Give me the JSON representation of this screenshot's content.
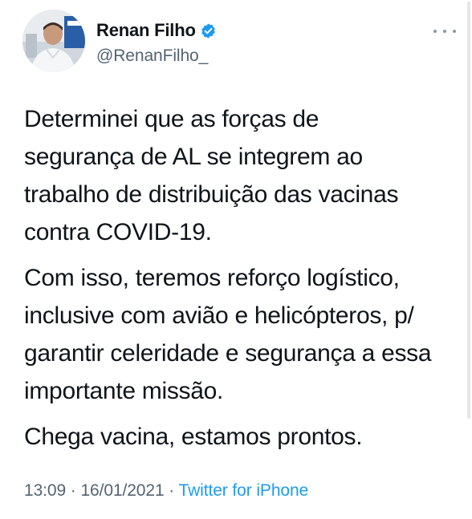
{
  "author": {
    "display_name": "Renan Filho",
    "handle": "@RenanFilho_",
    "verified_icon": "verified-badge-icon"
  },
  "menu": {
    "icon": "more-options-icon"
  },
  "tweet": {
    "paragraphs": [
      "Determinei que as forças de\nsegurança de AL se integrem ao\ntrabalho de distribuição das vacinas\ncontra COVID-19.",
      "Com isso, teremos reforço logístico,\ninclusive com avião e helicópteros, p/\ngarantir celeridade e segurança a essa\nimportante missão.",
      "Chega vacina, estamos prontos."
    ]
  },
  "meta": {
    "time": "13:09",
    "separator1": " · ",
    "date": "16/01/2021",
    "separator2": " · ",
    "source": "Twitter for iPhone"
  },
  "colors": {
    "text": "#0f1419",
    "secondary": "#536471",
    "accent": "#1d9bf0"
  }
}
